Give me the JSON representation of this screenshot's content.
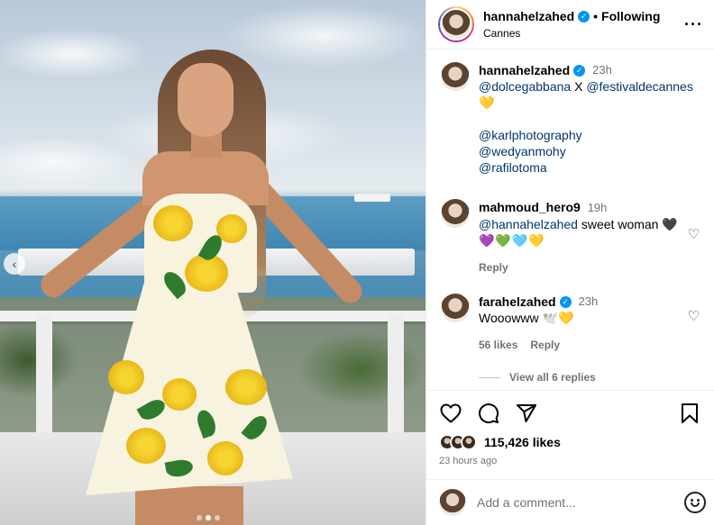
{
  "post": {
    "author": "hannahelzahed",
    "verified": true,
    "separator": "•",
    "follow_label": "Following",
    "location": "Cannes",
    "more_icon": "more-horizontal-icon"
  },
  "caption": {
    "username": "hannahelzahed",
    "time": "23h",
    "mention1": "@dolcegabbana",
    "connector": " X ",
    "mention2": "@festivaldecannes",
    "emoji": "💛",
    "credits": [
      "@karlphotography",
      "@wedyanmohy",
      "@rafilotoma"
    ]
  },
  "comments": [
    {
      "username": "mahmoud_hero9",
      "time": "19h",
      "mention": "@hannahelzahed",
      "text": " sweet woman 🖤",
      "emoji_line": "💜💚🩵💛",
      "reply_label": "Reply"
    },
    {
      "username": "farahelzahed",
      "verified": true,
      "time": "23h",
      "text": "Wooowww 🕊️💛",
      "likes_label": "56 likes",
      "reply_label": "Reply",
      "view_replies": "View all 6 replies"
    }
  ],
  "actions": {
    "likes": "115,426 likes",
    "posted_ago": "23 hours ago",
    "icons": [
      "heart-icon",
      "comment-icon",
      "share-icon",
      "bookmark-icon"
    ]
  },
  "add_comment": {
    "placeholder": "Add a comment..."
  },
  "carousel": {
    "prev_label": "‹",
    "slide_count": 3,
    "active_slide": 2
  },
  "colors": {
    "verified": "#0095f6",
    "mention": "#00376b",
    "muted": "#737373",
    "dress_yellow": "#f7d531",
    "leaf_green": "#2f7b2e"
  }
}
